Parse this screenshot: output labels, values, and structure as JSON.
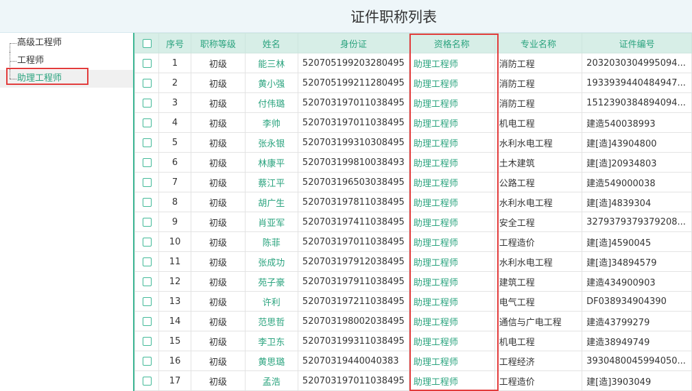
{
  "header": {
    "title": "证件职称列表"
  },
  "tree": {
    "items": [
      {
        "label": "高级工程师"
      },
      {
        "label": "工程师"
      },
      {
        "label": "助理工程师"
      }
    ]
  },
  "table": {
    "columns": [
      "序号",
      "职称等级",
      "姓名",
      "身份证",
      "资格名称",
      "专业名称",
      "证件编号"
    ],
    "rows": [
      [
        "1",
        "初级",
        "能三林",
        "520705199203280495",
        "助理工程师",
        "消防工程",
        "2032030304995094..."
      ],
      [
        "2",
        "初级",
        "黄小强",
        "520705199211280495",
        "助理工程师",
        "消防工程",
        "1933939440484947..."
      ],
      [
        "3",
        "初级",
        "付伟璐",
        "520703197011038495",
        "助理工程师",
        "消防工程",
        "1512390384894094..."
      ],
      [
        "4",
        "初级",
        "李帅",
        "520703197011038495",
        "助理工程师",
        "机电工程",
        "建造540038993"
      ],
      [
        "5",
        "初级",
        "张永银",
        "520703199310308495",
        "助理工程师",
        "水利水电工程",
        "建[造]43904800"
      ],
      [
        "6",
        "初级",
        "林康平",
        "520703199810038493",
        "助理工程师",
        "土木建筑",
        "建[造]20934803"
      ],
      [
        "7",
        "初级",
        "蔡江平",
        "520703196503038495",
        "助理工程师",
        "公路工程",
        "建造549000038"
      ],
      [
        "8",
        "初级",
        "胡广生",
        "520703197811038495",
        "助理工程师",
        "水利水电工程",
        "建[造]4839304"
      ],
      [
        "9",
        "初级",
        "肖亚军",
        "520703197411038495",
        "助理工程师",
        "安全工程",
        "3279379379379208..."
      ],
      [
        "10",
        "初级",
        "陈菲",
        "520703197011038495",
        "助理工程师",
        "工程造价",
        "建[造]4590045"
      ],
      [
        "11",
        "初级",
        "张成功",
        "520703197912038495",
        "助理工程师",
        "水利水电工程",
        "建[造]34894579"
      ],
      [
        "12",
        "初级",
        "苑子豪",
        "520703197911038495",
        "助理工程师",
        "建筑工程",
        "建造434900903"
      ],
      [
        "13",
        "初级",
        "许利",
        "520703197211038495",
        "助理工程师",
        "电气工程",
        "DF038934904390"
      ],
      [
        "14",
        "初级",
        "范思哲",
        "520703198002038495",
        "助理工程师",
        "通信与广电工程",
        "建造43799279"
      ],
      [
        "15",
        "初级",
        "李卫东",
        "520703199311038495",
        "助理工程师",
        "机电工程",
        "建造38949749"
      ],
      [
        "16",
        "初级",
        "黄思璐",
        "52070319440040383",
        "助理工程师",
        "工程经济",
        "3930480045994050..."
      ],
      [
        "17",
        "初级",
        "孟浩",
        "520703197011038495",
        "助理工程师",
        "工程造价",
        "建[造]3903049"
      ]
    ]
  },
  "colors": {
    "accent": "#2aa37e",
    "header_bg": "#d7eee7",
    "highlight": "#e23a3a"
  }
}
